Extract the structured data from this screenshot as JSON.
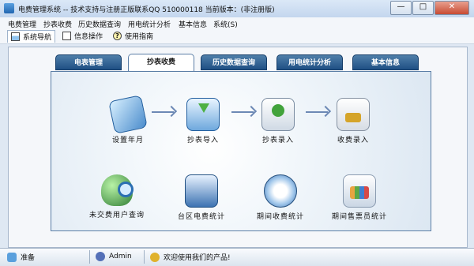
{
  "window": {
    "title": "电费管理系统 -- 技术支持与注册正版联系QQ 510000118   当前版本：(非注册版)",
    "minimize": "—",
    "maximize": "□",
    "close": "✕"
  },
  "menu": [
    "电费管理",
    "抄表收费",
    "历史数据查询",
    "用电统计分析",
    "基本信息",
    "系统(S)"
  ],
  "toolbar": {
    "items": [
      {
        "label": "系统导航",
        "icon": "navigation-icon"
      },
      {
        "label": "信息操作",
        "icon": "document-icon"
      },
      {
        "label": "使用指南",
        "icon": "help-icon"
      }
    ]
  },
  "tabs": [
    "电表管理",
    "抄表收费",
    "历史数据查询",
    "用电统计分析",
    "基本信息"
  ],
  "functions": {
    "row1": [
      "设置年月",
      "抄表导入",
      "抄表录入",
      "收费录入"
    ],
    "row2": [
      "未交费用户查询",
      "台区电费统计",
      "期间收费统计",
      "期间售票员统计"
    ]
  },
  "status": {
    "ready": "准备",
    "user": "Admin",
    "welcome": "欢迎使用我们的产品!"
  },
  "colors": {
    "tab": "#2c5d91",
    "arrow": "#6d89b5"
  }
}
